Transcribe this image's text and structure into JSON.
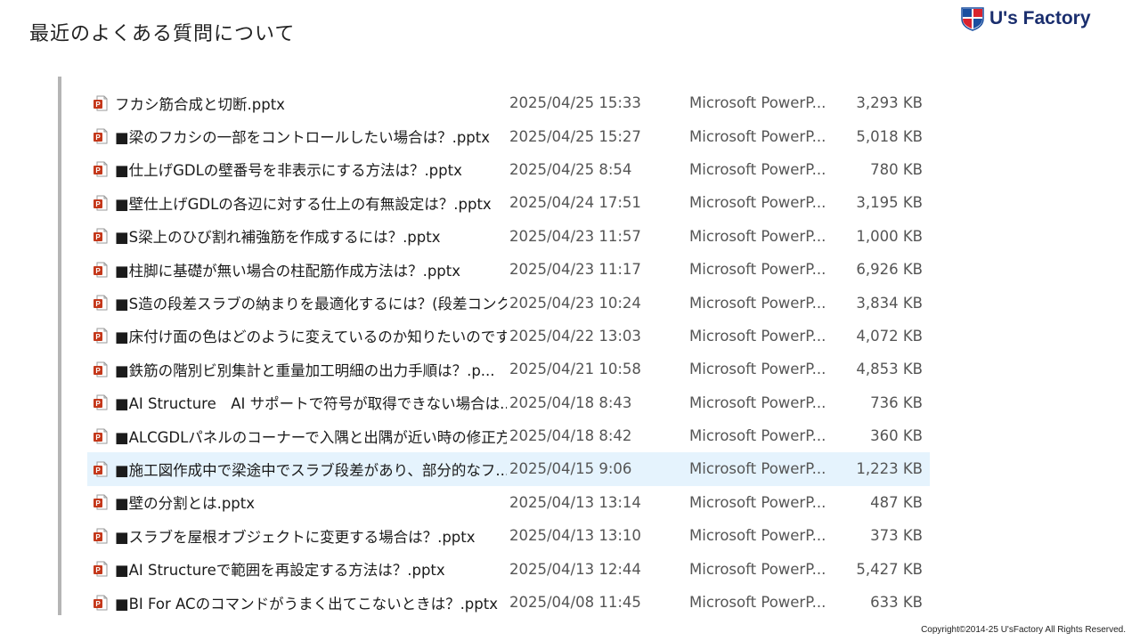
{
  "slide": {
    "title": "最近のよくある質問について",
    "copyright": "Copyright©2014-25  U'sFactory All Rights Reserved."
  },
  "logo": {
    "text": "U's Factory",
    "colors": {
      "blue": "#1a4fa0",
      "red": "#d9232e",
      "navy": "#1a2e6e"
    }
  },
  "explorer": {
    "icon": "powerpoint-file-icon",
    "selected_color": "#e5f3fd",
    "files": [
      {
        "name": "フカシ筋合成と切断.pptx",
        "date": "2025/04/25 15:33",
        "type": "Microsoft PowerP...",
        "size": "3,293 KB"
      },
      {
        "name": "■梁のフカシの一部をコントロールしたい場合は？.pptx",
        "date": "2025/04/25 15:27",
        "type": "Microsoft PowerP...",
        "size": "5,018 KB"
      },
      {
        "name": "■仕上げGDLの壁番号を非表示にする方法は？.pptx",
        "date": "2025/04/25 8:54",
        "type": "Microsoft PowerP...",
        "size": "780 KB"
      },
      {
        "name": "■壁仕上げGDLの各辺に対する仕上の有無設定は？.pptx",
        "date": "2025/04/24 17:51",
        "type": "Microsoft PowerP...",
        "size": "3,195 KB"
      },
      {
        "name": "■S梁上のひび割れ補強筋を作成するには？.pptx",
        "date": "2025/04/23 11:57",
        "type": "Microsoft PowerP...",
        "size": "1,000 KB"
      },
      {
        "name": "■柱脚に基礎が無い場合の柱配筋作成方法は？.pptx",
        "date": "2025/04/23 11:17",
        "type": "Microsoft PowerP...",
        "size": "6,926 KB"
      },
      {
        "name": "■S造の段差スラブの納まりを最適化するには？(段差コンク...",
        "date": "2025/04/23 10:24",
        "type": "Microsoft PowerP...",
        "size": "3,834 KB"
      },
      {
        "name": "■床付け面の色はどのように変えているのか知りたいのですが...",
        "date": "2025/04/22 13:03",
        "type": "Microsoft PowerP...",
        "size": "4,072 KB"
      },
      {
        "name": "■鉄筋の階別ビ別集計と重量加工明細の出力手順は？.p...",
        "date": "2025/04/21 10:58",
        "type": "Microsoft PowerP...",
        "size": "4,853 KB"
      },
      {
        "name": "■AI Structure　AI サポートで符号が取得できない場合は...",
        "date": "2025/04/18 8:43",
        "type": "Microsoft PowerP...",
        "size": "736 KB"
      },
      {
        "name": "■ALCGDLパネルのコーナーで入隅と出隅が近い時の修正方...",
        "date": "2025/04/18 8:42",
        "type": "Microsoft PowerP...",
        "size": "360 KB"
      },
      {
        "name": "■施工図作成中で梁途中でスラブ段差があり、部分的なフ...",
        "date": "2025/04/15 9:06",
        "type": "Microsoft PowerP...",
        "size": "1,223 KB",
        "selected": true
      },
      {
        "name": "■壁の分割とは.pptx",
        "date": "2025/04/13 13:14",
        "type": "Microsoft PowerP...",
        "size": "487 KB"
      },
      {
        "name": "■スラブを屋根オブジェクトに変更する場合は？.pptx",
        "date": "2025/04/13 13:10",
        "type": "Microsoft PowerP...",
        "size": "373 KB"
      },
      {
        "name": "■AI Structureで範囲を再設定する方法は？.pptx",
        "date": "2025/04/13 12:44",
        "type": "Microsoft PowerP...",
        "size": "5,427 KB"
      },
      {
        "name": "■BI For ACのコマンドがうまく出てこないときは？.pptx",
        "date": "2025/04/08 11:45",
        "type": "Microsoft PowerP...",
        "size": "633 KB"
      }
    ]
  }
}
